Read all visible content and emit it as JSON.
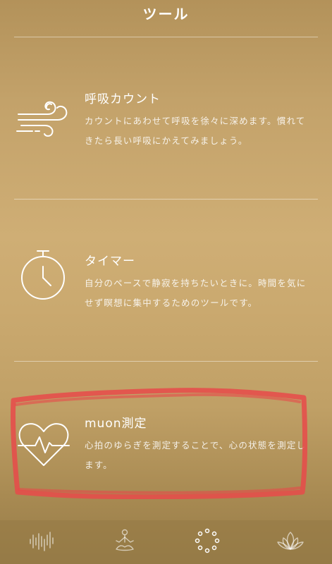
{
  "header": {
    "title": "ツール"
  },
  "tools": [
    {
      "icon": "wind-icon",
      "title": "呼吸カウント",
      "description": "カウントにあわせて呼吸を徐々に深めます。慣れてきたら長い呼吸にかえてみましょう。"
    },
    {
      "icon": "stopwatch-icon",
      "title": "タイマー",
      "description": "自分のペースで静寂を持ちたいときに。時間を気にせず瞑想に集中するためのツールです。"
    },
    {
      "icon": "heart-pulse-icon",
      "title": "muon測定",
      "description": "心拍のゆらぎを測定することで、心の状態を測定します。"
    }
  ],
  "tabbar": {
    "items": [
      {
        "icon": "sound-wave-icon",
        "active": false
      },
      {
        "icon": "meditation-icon",
        "active": false
      },
      {
        "icon": "dots-circle-icon",
        "active": true
      },
      {
        "icon": "lotus-icon",
        "active": false
      }
    ]
  },
  "colors": {
    "highlight_stroke": "#e84a4a",
    "text": "#ffffff"
  }
}
